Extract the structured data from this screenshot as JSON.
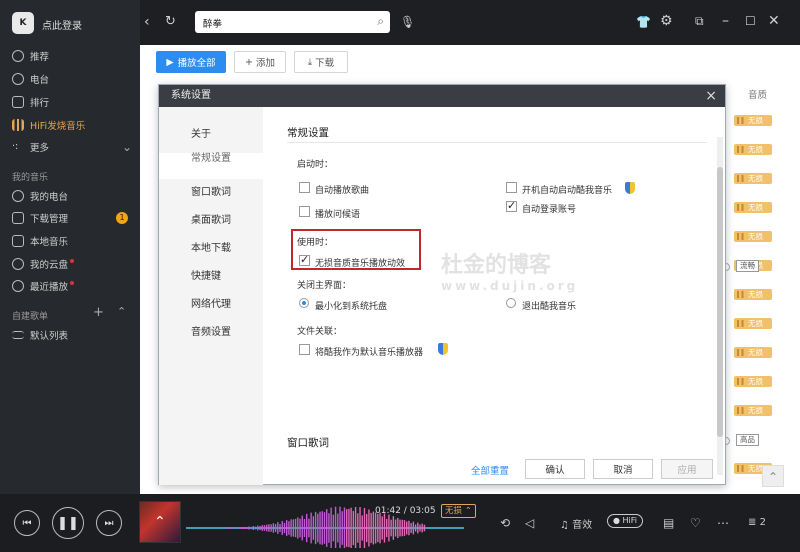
{
  "sidebar": {
    "login": "点此登录",
    "logo_text": "K",
    "nav": [
      {
        "label": "推荐",
        "icon": "recommend-icon"
      },
      {
        "label": "电台",
        "icon": "radio-icon"
      },
      {
        "label": "排行",
        "icon": "ranking-icon"
      },
      {
        "label": "HiFi发烧音乐",
        "icon": "hifi-icon"
      },
      {
        "label": "更多",
        "icon": "more-icon"
      }
    ],
    "my_music_title": "我的音乐",
    "my_music": [
      {
        "label": "我的电台",
        "icon": "my-radio-icon"
      },
      {
        "label": "下载管理",
        "icon": "download-icon",
        "badge": "1"
      },
      {
        "label": "本地音乐",
        "icon": "local-music-icon"
      },
      {
        "label": "我的云盘",
        "icon": "cloud-icon"
      },
      {
        "label": "最近播放",
        "icon": "recent-icon"
      }
    ],
    "playlist_title": "自建歌单",
    "playlists": [
      {
        "label": "默认列表"
      }
    ]
  },
  "topbar": {
    "search_value": "醉拳",
    "icons": [
      "back-icon",
      "refresh-icon",
      "search-icon",
      "mic-icon",
      "skin-icon",
      "settings-icon",
      "mini-mode-icon",
      "minimize-icon",
      "maximize-icon",
      "close-icon"
    ]
  },
  "toolbar": {
    "play_all": "播放全部",
    "add": "添加",
    "download": "下载"
  },
  "list": {
    "quality_header": "音质",
    "rows": [
      {
        "quality": "无损"
      },
      {
        "quality": "无损"
      },
      {
        "quality": "无损"
      },
      {
        "quality": "无损"
      },
      {
        "quality": "无损"
      },
      {
        "quality": "无损"
      },
      {
        "quality": "流畅"
      },
      {
        "quality": "无损"
      },
      {
        "quality": "无损"
      },
      {
        "quality": "无损"
      },
      {
        "quality": "无损"
      },
      {
        "quality": "无损"
      },
      {
        "quality": "高品"
      },
      {
        "quality": "无损"
      }
    ]
  },
  "dialog": {
    "title": "系统设置",
    "menu": [
      "关于",
      "常规设置",
      "窗口歌词",
      "桌面歌词",
      "本地下载",
      "快捷键",
      "网络代理",
      "音频设置"
    ],
    "active_menu": "常规设置",
    "section_title": "常规设置",
    "startup_label": "启动时：",
    "startup_options": [
      {
        "label": "自动播放歌曲",
        "checked": false
      },
      {
        "label": "开机自动启动酷我音乐",
        "checked": false
      },
      {
        "label": "播放问候语",
        "checked": false
      },
      {
        "label": "自动登录账号",
        "checked": true
      }
    ],
    "using_label": "使用时：",
    "using_option": {
      "label": "无损音质音乐播放动效",
      "checked": true
    },
    "close_label": "关闭主界面：",
    "close_options": [
      {
        "label": "最小化到系统托盘",
        "selected": true
      },
      {
        "label": "退出酷我音乐",
        "selected": false
      }
    ],
    "assoc_label": "文件关联：",
    "assoc_option": {
      "label": "将酷我作为默认音乐播放器",
      "checked": false
    },
    "next_section": "窗口歌词",
    "reset_all": "全部重置",
    "ok": "确认",
    "cancel": "取消",
    "apply": "应用"
  },
  "watermark": {
    "title": "杜金的博客",
    "url": "www.dujin.org"
  },
  "player": {
    "time": "01:42 / 03:05",
    "quality": "无损",
    "effect": "音效",
    "hifi": "HiFi",
    "queue_count": "2",
    "progress": 0.55
  }
}
